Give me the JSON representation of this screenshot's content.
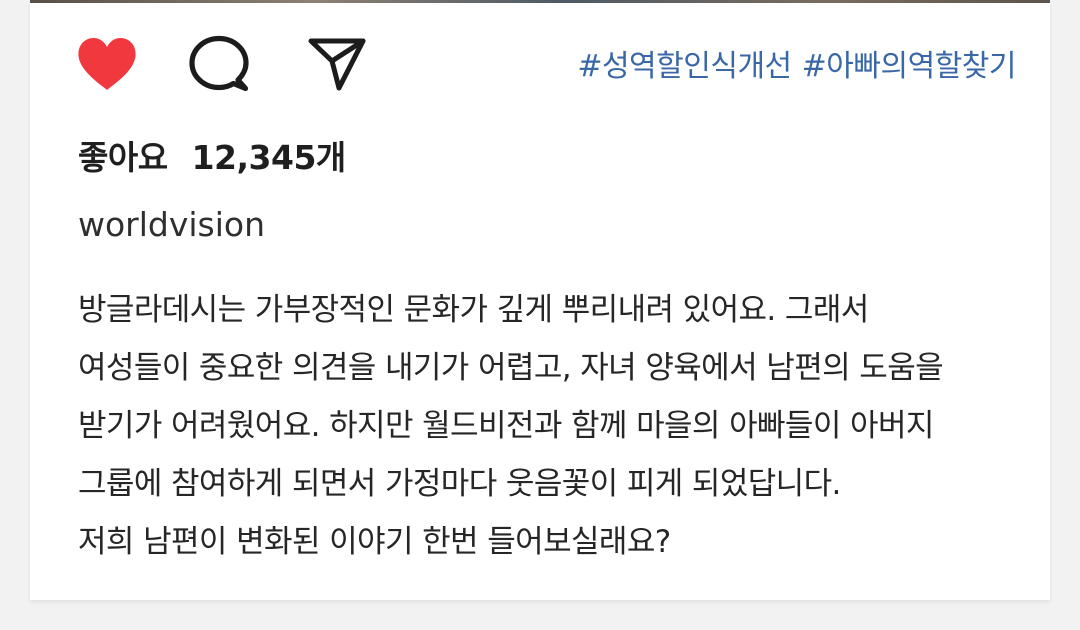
{
  "post": {
    "actions": {
      "like_icon": "heart-filled-icon",
      "comment_icon": "speech-bubble-icon",
      "share_icon": "paper-plane-icon",
      "like_color": "#f0383e"
    },
    "hashtags": [
      "#성역할인식개선",
      "#아빠의역할찾기"
    ],
    "likes": {
      "label": "좋아요",
      "count": "12,345개"
    },
    "username": "worldvision",
    "caption_lines": [
      "방글라데시는 가부장적인 문화가 깊게 뿌리내려 있어요. 그래서",
      "여성들이 중요한 의견을 내기가 어렵고, 자녀 양육에서 남편의 도움을",
      "받기가 어려웠어요. 하지만 월드비전과 함께 마을의 아빠들이 아버지",
      "그룹에 참여하게 되면서 가정마다 웃음꽃이 피게 되었답니다.",
      "저희 남편이 변화된 이야기 한번 들어보실래요?"
    ],
    "colors": {
      "hashtag": "#3a67a6",
      "text": "#262626",
      "background": "#ffffff"
    }
  }
}
